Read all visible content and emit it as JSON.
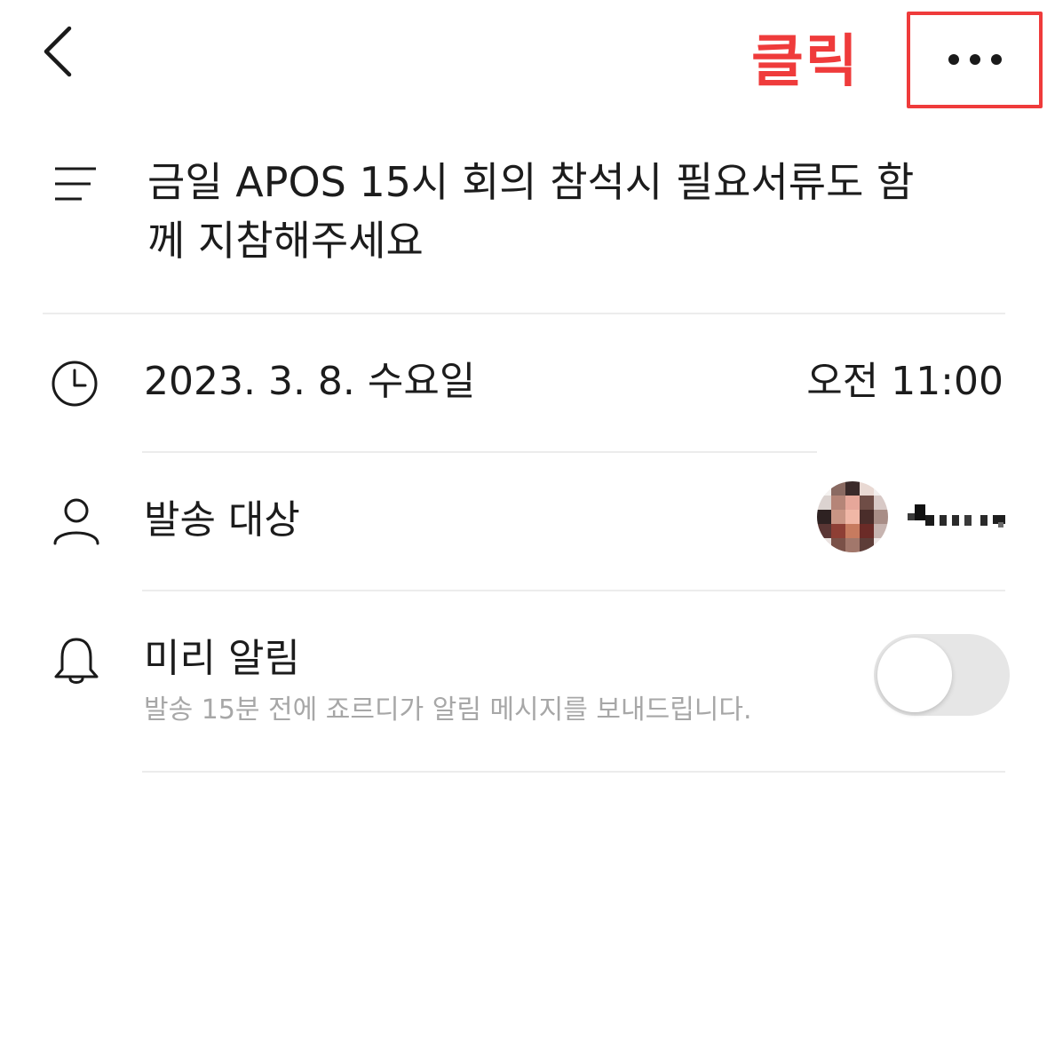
{
  "header": {
    "back_icon": "chevron-left-icon",
    "more_icon": "more-horizontal-icon",
    "annotation_label": "클릭",
    "annotation_color": "#ef3b3b"
  },
  "memo": {
    "icon": "text-lines-icon",
    "text_line1": "금일 APOS 15시 회의 참석시 필요서류도 함",
    "text_line2": "께 지참해주세요"
  },
  "schedule": {
    "icon": "clock-icon",
    "date": "2023. 3. 8. 수요일",
    "time": "오전 11:00"
  },
  "recipient": {
    "icon": "person-icon",
    "label": "발송 대상"
  },
  "reminder": {
    "icon": "bell-icon",
    "label": "미리 알림",
    "description": "발송 15분 전에 죠르디가 알림 메시지를 보내드립니다.",
    "enabled": false
  }
}
